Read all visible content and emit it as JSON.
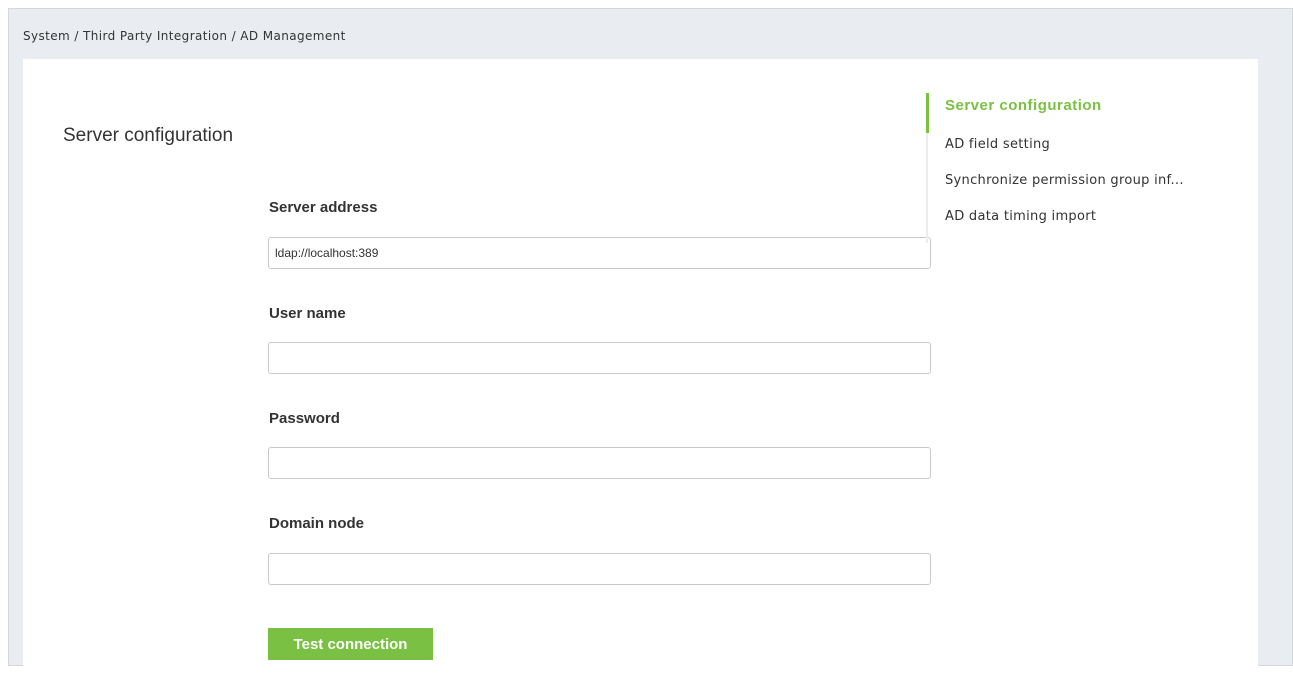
{
  "breadcrumb": {
    "text": "System / Third Party Integration / AD Management"
  },
  "page": {
    "title": "Server configuration"
  },
  "form": {
    "server_address": {
      "label": "Server address",
      "value": "ldap://localhost:389",
      "placeholder": ""
    },
    "user_name": {
      "label": "User name",
      "value": "",
      "placeholder": ""
    },
    "password": {
      "label": "Password",
      "value": "",
      "placeholder": ""
    },
    "domain_node": {
      "label": "Domain node",
      "value": "",
      "placeholder": ""
    },
    "test_button_label": "Test connection"
  },
  "side_nav": {
    "items": [
      {
        "label": "Server configuration",
        "active": true
      },
      {
        "label": "AD field setting",
        "active": false
      },
      {
        "label": "Synchronize permission group inf...",
        "active": false
      },
      {
        "label": "AD data timing import",
        "active": false
      }
    ]
  },
  "colors": {
    "accent": "#7ac143",
    "background": "#e9edf1",
    "panel": "#ffffff",
    "text": "#333333"
  }
}
